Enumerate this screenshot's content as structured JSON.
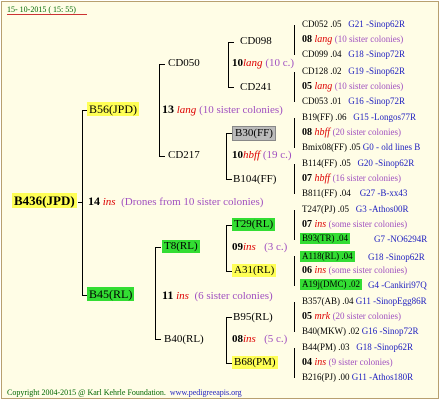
{
  "header": {
    "date": "15- 10-2015 ( 15: 55)"
  },
  "footer": {
    "copyright": "Copyright 2004-2015 @ Karl Kehrle Foundation.",
    "url": "www.pedigreeapis.org"
  },
  "root": {
    "id": "B436(JPD)",
    "drone_num": "14",
    "drone_sym": "ins",
    "drone_note": "(Drones from 10 sister colonies)"
  },
  "gen1": [
    {
      "id": "B56(JPD)",
      "num": "13",
      "sym": "lang",
      "note": "(10 sister colonies)"
    },
    {
      "id": "B45(RL)",
      "num": "11",
      "sym": "ins",
      "note": "(6 sister colonies)"
    }
  ],
  "gen2": [
    {
      "id": "CD050",
      "num": "10",
      "sym": "lang",
      "note": "(10 c.)"
    },
    {
      "id": "CD217",
      "num": "10",
      "sym": "hbff",
      "note": "(19 c.)"
    },
    {
      "id": "T8(RL)",
      "num": "09",
      "sym": "ins",
      "note": "(3 c.)"
    },
    {
      "id": "B40(RL)",
      "num": "08",
      "sym": "ins",
      "note": "(5 c.)"
    }
  ],
  "gen3": [
    "CD098",
    "CD241",
    "B30(FF)",
    "B104(FF)",
    "T29(RL)",
    "A31(RL)",
    "B95(RL)",
    "B68(PM)"
  ],
  "gen4": [
    {
      "id": "CD052",
      "year": ".05",
      "code": "G21 -Sinop62R"
    },
    {
      "num": "08",
      "sym": "lang",
      "note": "(10 sister colonies)"
    },
    {
      "id": "CD099",
      "year": ".04",
      "code": "G18 -Sinop72R"
    },
    {
      "id": "CD128",
      "year": ".02",
      "code": "G19 -Sinop62R"
    },
    {
      "num": "05",
      "sym": "lang",
      "note": "(10 sister colonies)"
    },
    {
      "id": "CD053",
      "year": ".01",
      "code": "G16 -Sinop72R"
    },
    {
      "id": "B19(FF)",
      "year": ".06",
      "code": "G15 -Longos77R"
    },
    {
      "num": "08",
      "sym": "hbff",
      "note": "(20 sister colonies)"
    },
    {
      "id": "Bmix08(FF)",
      "year": ".05",
      "code": "G0 - old lines B"
    },
    {
      "id": "B114(FF)",
      "year": ".05",
      "code": "G20 -Sinop62R"
    },
    {
      "num": "07",
      "sym": "hbff",
      "note": "(16 sister colonies)"
    },
    {
      "id": "B811(FF)",
      "year": ".04",
      "code": "G27 -B-xx43"
    },
    {
      "id": "T247(PJ)",
      "year": ".05",
      "code": "G3 -Athos00R"
    },
    {
      "num": "07",
      "sym": "ins",
      "note": "(some sister colonies)"
    },
    {
      "id": "B93(TR)",
      "year": ".04",
      "code": "G7 -NO6294R"
    },
    {
      "id": "A118(RL)",
      "year": ".04",
      "code": "G18 -Sinop62R"
    },
    {
      "num": "06",
      "sym": "ins",
      "note": "(some sister colonies)"
    },
    {
      "id": "A19j(DMC)",
      "year": ".02",
      "code": "G4 -Cankiri97Q"
    },
    {
      "id": "B357(AB)",
      "year": ".04",
      "code": "G11 -SinopEgg86R"
    },
    {
      "num": "05",
      "sym": "mrk",
      "note": "(20 sister colonies)"
    },
    {
      "id": "B40(MKW)",
      "year": ".02",
      "code": "G16 -Sinop72R"
    },
    {
      "id": "B44(PM)",
      "year": ".03",
      "code": "G18 -Sinop62R"
    },
    {
      "num": "04",
      "sym": "ins",
      "note": "(9 sister colonies)"
    },
    {
      "id": "B216(PJ)",
      "year": ".00",
      "code": "G11 -Athos180R"
    }
  ]
}
